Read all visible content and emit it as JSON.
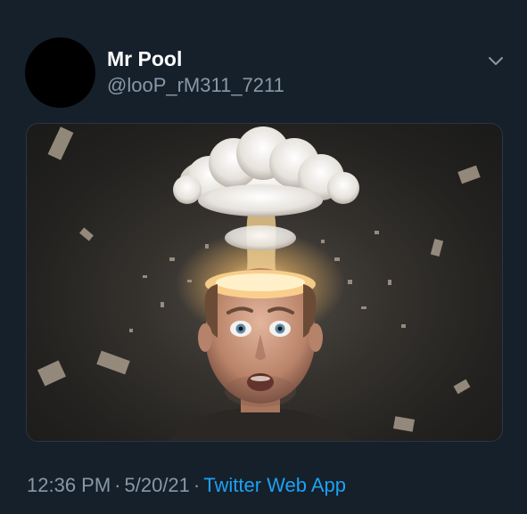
{
  "top_partial_text": "",
  "tweet": {
    "display_name": "Mr Pool",
    "handle": "@looP_rM311_7211",
    "time": "12:36 PM",
    "separator": "·",
    "date": "5/20/21",
    "source": "Twitter Web App"
  },
  "icons": {
    "menu": "chevron-down-icon",
    "avatar": "avatar"
  },
  "colors": {
    "background": "#15202b",
    "primary_text": "#ffffff",
    "secondary_text": "#8899a6",
    "link": "#1da1f2",
    "avatar": "#000000"
  }
}
